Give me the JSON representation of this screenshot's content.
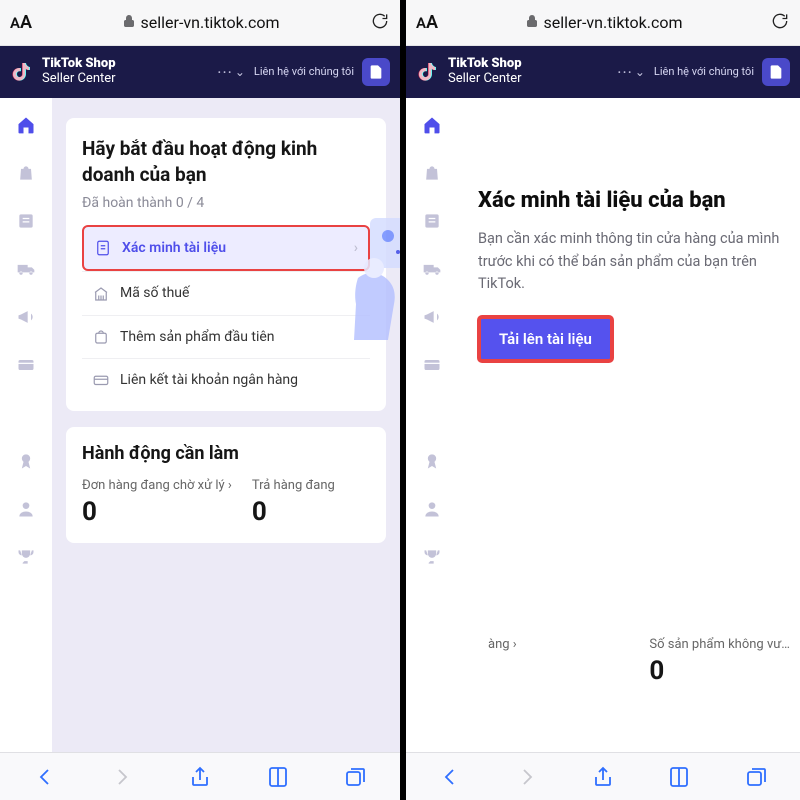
{
  "browser": {
    "url": "seller-vn.tiktok.com",
    "text_size_small": "A",
    "text_size_large": "A"
  },
  "header": {
    "brand_line1": "TikTok Shop",
    "brand_line2": "Seller Center",
    "contact": "Liên hệ với chúng tôi"
  },
  "left": {
    "card": {
      "title": "Hãy bắt đầu hoạt động kinh doanh của bạn",
      "progress": "Đã hoàn thành 0 / 4",
      "steps": [
        {
          "label": "Xác minh tài liệu",
          "icon": "verify-doc-icon",
          "highlight": true
        },
        {
          "label": "Mã số thuế",
          "icon": "tax-icon",
          "highlight": false
        },
        {
          "label": "Thêm sản phẩm đầu tiên",
          "icon": "product-icon",
          "highlight": false
        },
        {
          "label": "Liên kết tài khoản ngân hàng",
          "icon": "bank-icon",
          "highlight": false
        }
      ]
    },
    "todo": {
      "title": "Hành động cần làm",
      "metrics": [
        {
          "label": "Đơn hàng đang chờ xử lý ›",
          "value": "0"
        },
        {
          "label": "Trả hàng đang",
          "value": "0"
        }
      ]
    }
  },
  "right": {
    "verify": {
      "title": "Xác minh tài liệu của bạn",
      "desc": "Bạn cần xác minh thông tin cửa hàng của mình trước khi có thể bán sản phẩm của bạn trên TikTok.",
      "button": "Tải lên tài liệu"
    },
    "bottom_metrics": [
      {
        "label": "àng ›",
        "value": ""
      },
      {
        "label": "Số sản phẩm không vư…",
        "value": "0"
      }
    ]
  },
  "rail_icons": [
    "home",
    "bag",
    "list",
    "truck",
    "megaphone",
    "card",
    "bars",
    "medal",
    "user",
    "trophy"
  ]
}
